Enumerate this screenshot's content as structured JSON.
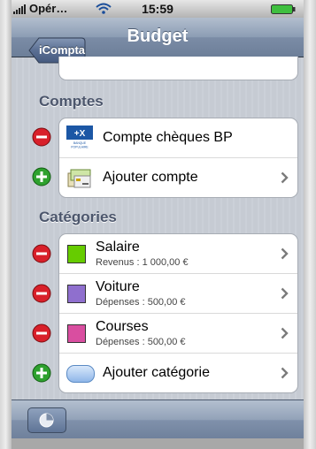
{
  "statusbar": {
    "carrier": "Opér…",
    "time": "15:59"
  },
  "navbar": {
    "back_label": "iCompta",
    "title": "Budget"
  },
  "sections": {
    "accounts": "Comptes",
    "categories": "Catégories"
  },
  "accounts": [
    {
      "label": "Compte chèques BP"
    },
    {
      "label": "Ajouter compte"
    }
  ],
  "categories": [
    {
      "name": "Salaire",
      "detail": "Revenus : 1 000,00 €",
      "color": "#66cc00"
    },
    {
      "name": "Voiture",
      "detail": "Dépenses : 500,00 €",
      "color": "#8f6fce"
    },
    {
      "name": "Courses",
      "detail": "Dépenses : 500,00 €",
      "color": "#d94ea0"
    }
  ],
  "add_category": {
    "label": "Ajouter catégorie"
  },
  "bank_logo_text": "BANQUE POPULAIRE",
  "colors": {
    "delete": "#d8202a",
    "add": "#2ea12e",
    "navbar": "#7b8ca6"
  }
}
